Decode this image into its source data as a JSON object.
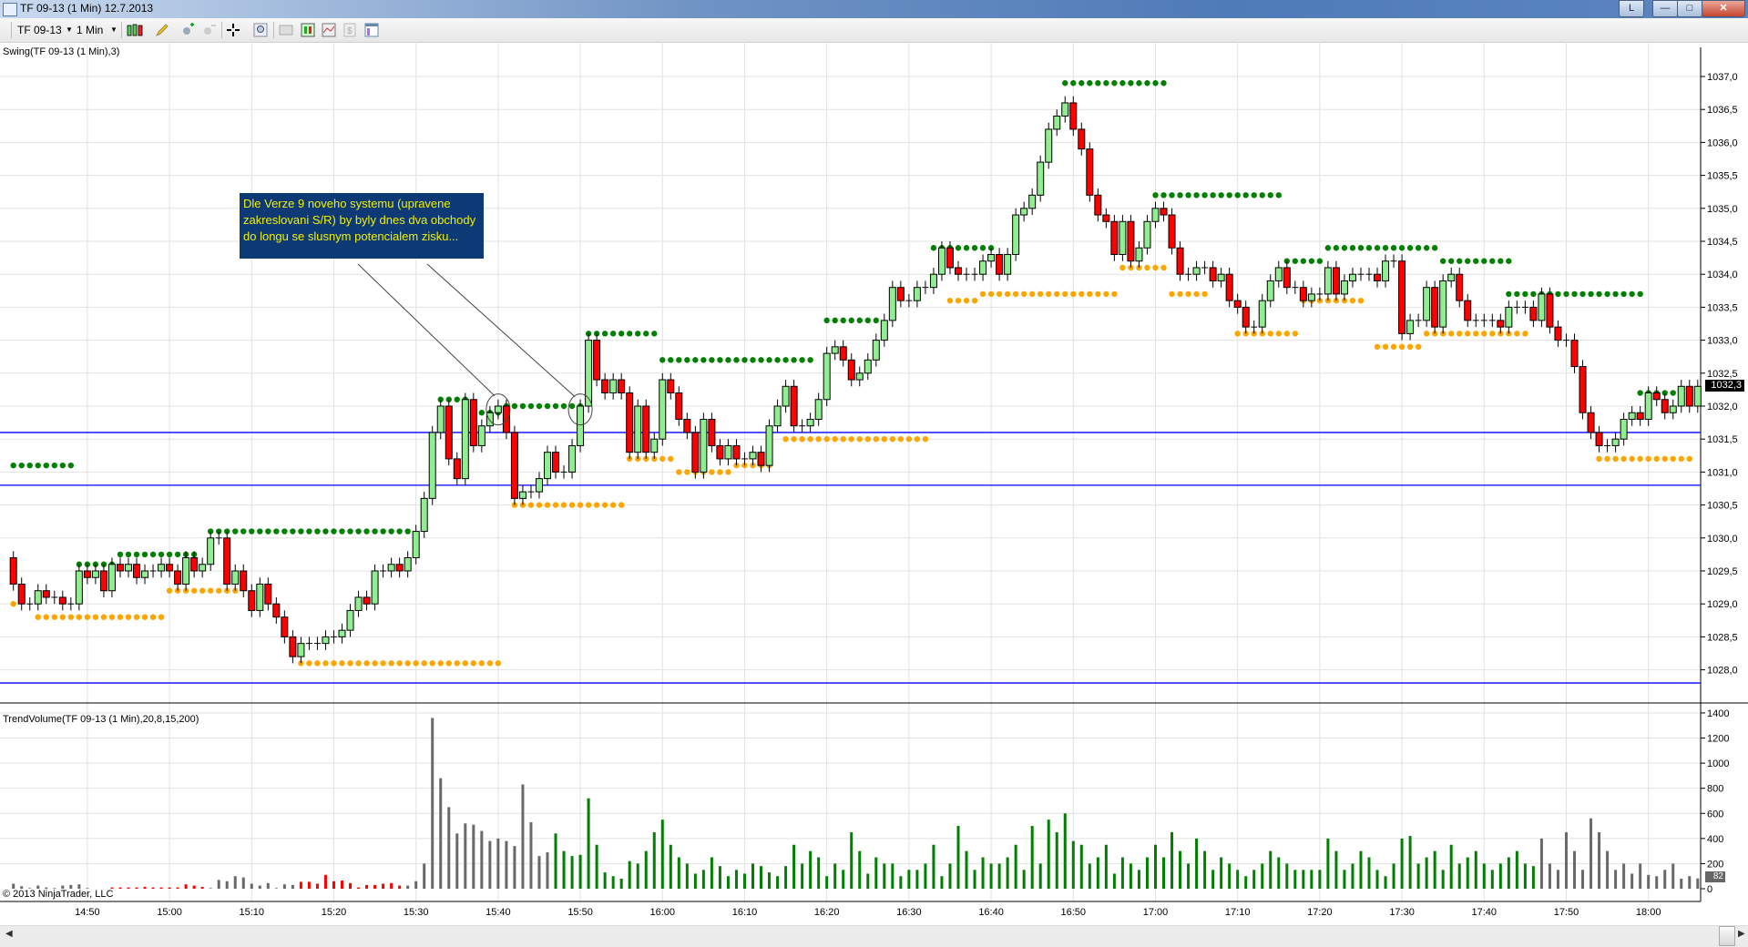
{
  "window": {
    "title": "TF 09-13 (1 Min)  12.7.2013",
    "ribbon_btn": "L",
    "minimize": "—",
    "maximize": "□",
    "close": "✕"
  },
  "toolbar": {
    "instrument": "TF 09-13",
    "interval": "1 Min",
    "icons": [
      "bar-type-icon",
      "drawing-pencil-icon",
      "zoom-in-icon",
      "zoom-out-icon",
      "crosshair-icon",
      "search-icon",
      "data-box-icon",
      "chart-style-icon",
      "indicators-icon",
      "strategies-icon",
      "properties-icon"
    ]
  },
  "price_panel": {
    "label": "Swing(TF 09-13 (1 Min),3)",
    "current_price_label": "1032,3"
  },
  "volume_panel": {
    "label": "TrendVolume(TF 09-13 (1 Min),20,8,15,200)",
    "current_volume_label": "82"
  },
  "copyright": "© 2013 NinjaTrader, LLC",
  "annotation": {
    "text": "Dle Verze 9 noveho systemu (upravene zakreslovani S/R) by byly dnes dva obchody do longu se slusnym potencialem zisku..."
  },
  "colors": {
    "up": "#90EE90",
    "down": "#FF0000",
    "resistance": "#008000",
    "support": "#FFA500",
    "hline": "#0000FF",
    "vol_gray": "#696969",
    "vol_red": "#FF0000",
    "vol_green": "#008000"
  },
  "chart_data": {
    "type": "candlestick",
    "instrument": "TF 09-13",
    "interval_minutes": 1,
    "start_time": "14:41",
    "first_open": 1029.7,
    "closes": [
      1029.3,
      1029.0,
      1029.0,
      1029.2,
      1029.1,
      1029.1,
      1029.0,
      1029.0,
      1029.5,
      1029.4,
      1029.5,
      1029.2,
      1029.6,
      1029.5,
      1029.6,
      1029.4,
      1029.5,
      1029.5,
      1029.6,
      1029.5,
      1029.3,
      1029.7,
      1029.5,
      1029.6,
      1030.0,
      1030.0,
      1029.3,
      1029.5,
      1029.2,
      1028.9,
      1029.3,
      1029.0,
      1028.8,
      1028.5,
      1028.2,
      1028.4,
      1028.4,
      1028.4,
      1028.5,
      1028.5,
      1028.6,
      1028.9,
      1029.1,
      1029.0,
      1029.5,
      1029.5,
      1029.6,
      1029.5,
      1029.7,
      1030.1,
      1030.6,
      1031.6,
      1032.0,
      1031.2,
      1030.9,
      1032.1,
      1031.4,
      1031.7,
      1031.9,
      1032.0,
      1031.6,
      1030.6,
      1030.7,
      1030.7,
      1030.9,
      1031.3,
      1031.0,
      1031.0,
      1031.4,
      1032.0,
      1033.0,
      1032.4,
      1032.2,
      1032.4,
      1032.2,
      1031.3,
      1032.0,
      1031.3,
      1031.5,
      1032.4,
      1032.2,
      1031.8,
      1031.6,
      1031.0,
      1031.8,
      1031.4,
      1031.2,
      1031.4,
      1031.2,
      1031.2,
      1031.3,
      1031.1,
      1031.7,
      1032.0,
      1032.3,
      1031.7,
      1031.7,
      1031.8,
      1032.1,
      1032.8,
      1032.9,
      1032.7,
      1032.4,
      1032.5,
      1032.7,
      1033.0,
      1033.3,
      1033.8,
      1033.6,
      1033.6,
      1033.8,
      1033.8,
      1034.0,
      1034.4,
      1034.1,
      1034.0,
      1034.0,
      1034.0,
      1034.2,
      1034.3,
      1034.0,
      1034.3,
      1034.9,
      1035.0,
      1035.2,
      1035.7,
      1036.2,
      1036.4,
      1036.6,
      1036.2,
      1035.9,
      1035.2,
      1034.9,
      1034.8,
      1034.3,
      1034.8,
      1034.2,
      1034.4,
      1034.8,
      1035.0,
      1034.9,
      1034.4,
      1034.0,
      1034.0,
      1034.1,
      1034.1,
      1033.9,
      1034.0,
      1033.6,
      1033.5,
      1033.2,
      1033.2,
      1033.6,
      1033.9,
      1034.1,
      1033.8,
      1033.8,
      1033.6,
      1033.7,
      1033.7,
      1034.1,
      1033.7,
      1033.9,
      1034.0,
      1034.0,
      1034.0,
      1033.9,
      1034.2,
      1034.2,
      1033.1,
      1033.3,
      1033.3,
      1033.8,
      1033.2,
      1033.9,
      1034.0,
      1033.6,
      1033.3,
      1033.3,
      1033.3,
      1033.3,
      1033.2,
      1033.5,
      1033.5,
      1033.5,
      1033.3,
      1033.7,
      1033.2,
      1033.0,
      1033.0,
      1032.6,
      1031.9,
      1031.6,
      1031.4,
      1031.4,
      1031.5,
      1031.8,
      1031.9,
      1031.8,
      1032.2,
      1032.1,
      1031.9,
      1032.0,
      1032.3,
      1032.0,
      1032.3
    ],
    "volume": [
      40,
      20,
      5,
      25,
      10,
      5,
      25,
      30,
      35,
      5,
      0,
      0,
      10,
      10,
      10,
      10,
      15,
      10,
      10,
      10,
      10,
      35,
      25,
      15,
      5,
      70,
      60,
      100,
      90,
      40,
      25,
      45,
      5,
      35,
      30,
      55,
      55,
      40,
      110,
      60,
      65,
      45,
      10,
      30,
      30,
      40,
      45,
      25,
      25,
      60,
      200,
      1360,
      880,
      650,
      440,
      520,
      510,
      460,
      380,
      400,
      380,
      340,
      830,
      530,
      260,
      290,
      440,
      300,
      260,
      270,
      720,
      350,
      130,
      100,
      80,
      220,
      200,
      300,
      450,
      550,
      350,
      250,
      200,
      120,
      150,
      250,
      180,
      100,
      150,
      120,
      200,
      180,
      130,
      100,
      180,
      350,
      200,
      300,
      250,
      100,
      200,
      150,
      450,
      300,
      120,
      250,
      200,
      200,
      100,
      150,
      150,
      200,
      350,
      100,
      200,
      500,
      300,
      150,
      250,
      200,
      200,
      250,
      350,
      150,
      500,
      200,
      550,
      450,
      600,
      380,
      350,
      200,
      250,
      350,
      120,
      250,
      200,
      150,
      250,
      350,
      250,
      450,
      300,
      200,
      400,
      300,
      150,
      250,
      200,
      150,
      100,
      150,
      200,
      300,
      250,
      200,
      150,
      150,
      150,
      150,
      400,
      300,
      150,
      200,
      300,
      250,
      150,
      100,
      200,
      400,
      420,
      200,
      250,
      300,
      150,
      350,
      200,
      250,
      300,
      200,
      150,
      200,
      250,
      300,
      200,
      180,
      400,
      200,
      150,
      450,
      300,
      150,
      560,
      450,
      300,
      150,
      200,
      120,
      200,
      110,
      100,
      150,
      200,
      80,
      100,
      82
    ],
    "volume_colors": [
      {
        "from": "14:41",
        "to": "14:52",
        "color": "gray"
      },
      {
        "from": "14:53",
        "to": "15:04",
        "color": "red"
      },
      {
        "from": "15:05",
        "to": "15:15",
        "color": "gray"
      },
      {
        "from": "15:16",
        "to": "15:28",
        "color": "red"
      },
      {
        "from": "15:29",
        "to": "15:46",
        "color": "gray"
      },
      {
        "from": "15:47",
        "to": "17:46",
        "color": "green"
      },
      {
        "from": "17:47",
        "to": "18:06",
        "color": "gray"
      }
    ],
    "resistance": [
      {
        "price": 1031.1,
        "from": "14:41",
        "to": "14:48"
      },
      {
        "price": 1029.6,
        "from": "14:49",
        "to": "14:53"
      },
      {
        "price": 1029.75,
        "from": "14:54",
        "to": "15:03"
      },
      {
        "price": 1030.1,
        "from": "15:05",
        "to": "15:29"
      },
      {
        "price": 1032.1,
        "from": "15:33",
        "to": "15:36"
      },
      {
        "price": 1031.9,
        "from": "15:37",
        "to": "15:40"
      },
      {
        "price": 1032.0,
        "from": "15:41",
        "to": "15:50"
      },
      {
        "price": 1033.1,
        "from": "15:51",
        "to": "15:59"
      },
      {
        "price": 1032.7,
        "from": "16:00",
        "to": "16:18"
      },
      {
        "price": 1033.3,
        "from": "16:20",
        "to": "16:26"
      },
      {
        "price": 1034.4,
        "from": "16:33",
        "to": "16:40"
      },
      {
        "price": 1036.9,
        "from": "16:49",
        "to": "17:01"
      },
      {
        "price": 1035.2,
        "from": "17:00",
        "to": "17:15"
      },
      {
        "price": 1034.2,
        "from": "17:16",
        "to": "17:20"
      },
      {
        "price": 1034.4,
        "from": "17:21",
        "to": "17:34"
      },
      {
        "price": 1034.2,
        "from": "17:35",
        "to": "17:43"
      },
      {
        "price": 1033.7,
        "from": "17:43",
        "to": "17:59"
      },
      {
        "price": 1032.2,
        "from": "17:59",
        "to": "18:03"
      }
    ],
    "support": [
      {
        "price": 1029.0,
        "from": "14:41",
        "to": "14:41"
      },
      {
        "price": 1028.8,
        "from": "14:44",
        "to": "14:59"
      },
      {
        "price": 1029.2,
        "from": "15:00",
        "to": "15:08"
      },
      {
        "price": 1028.1,
        "from": "15:16",
        "to": "15:40"
      },
      {
        "price": 1030.5,
        "from": "15:42",
        "to": "15:55"
      },
      {
        "price": 1031.2,
        "from": "15:56",
        "to": "16:01"
      },
      {
        "price": 1031.0,
        "from": "16:02",
        "to": "16:08"
      },
      {
        "price": 1031.1,
        "from": "16:09",
        "to": "16:13"
      },
      {
        "price": 1031.5,
        "from": "16:15",
        "to": "16:32"
      },
      {
        "price": 1033.6,
        "from": "16:35",
        "to": "16:38"
      },
      {
        "price": 1033.7,
        "from": "16:39",
        "to": "16:55"
      },
      {
        "price": 1034.1,
        "from": "16:56",
        "to": "17:01"
      },
      {
        "price": 1033.7,
        "from": "17:02",
        "to": "17:06"
      },
      {
        "price": 1033.1,
        "from": "17:10",
        "to": "17:17"
      },
      {
        "price": 1033.6,
        "from": "17:18",
        "to": "17:25"
      },
      {
        "price": 1032.9,
        "from": "17:27",
        "to": "17:32"
      },
      {
        "price": 1033.1,
        "from": "17:33",
        "to": "17:45"
      },
      {
        "price": 1031.2,
        "from": "17:54",
        "to": "18:05"
      }
    ],
    "horizontal_lines": [
      1031.6,
      1030.8,
      1027.8
    ],
    "annotation_circles": [
      "15:40",
      "15:50"
    ],
    "price_ylim": [
      1027.6,
      1037.2
    ],
    "price_ticks": [
      "1037,0",
      "1036,5",
      "1036,0",
      "1035,5",
      "1035,0",
      "1034,5",
      "1034,0",
      "1033,5",
      "1033,0",
      "1032,5",
      "1032,0",
      "1031,5",
      "1031,0",
      "1030,5",
      "1030,0",
      "1029,5",
      "1029,0",
      "1028,5",
      "1028,0"
    ],
    "volume_ticks": [
      "1400",
      "1200",
      "1000",
      "800",
      "600",
      "400",
      "200",
      "0"
    ],
    "time_ticks": [
      "14:50",
      "15:00",
      "15:10",
      "15:20",
      "15:30",
      "15:40",
      "15:50",
      "16:00",
      "16:10",
      "16:20",
      "16:30",
      "16:40",
      "16:50",
      "17:00",
      "17:10",
      "17:20",
      "17:30",
      "17:40",
      "17:50",
      "18:00"
    ]
  }
}
